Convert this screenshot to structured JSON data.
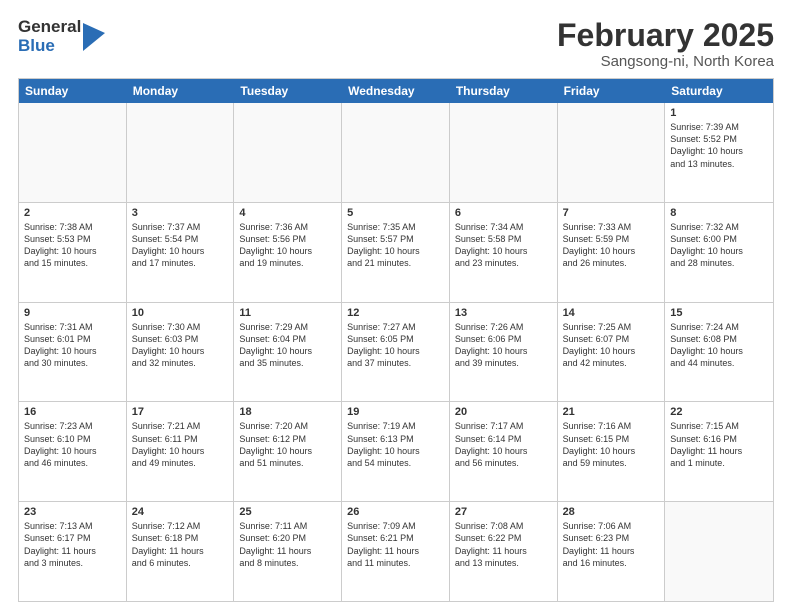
{
  "header": {
    "logo_general": "General",
    "logo_blue": "Blue",
    "title": "February 2025",
    "location": "Sangsong-ni, North Korea"
  },
  "calendar": {
    "days_of_week": [
      "Sunday",
      "Monday",
      "Tuesday",
      "Wednesday",
      "Thursday",
      "Friday",
      "Saturday"
    ],
    "rows": [
      [
        {
          "day": "",
          "info": "",
          "empty": true
        },
        {
          "day": "",
          "info": "",
          "empty": true
        },
        {
          "day": "",
          "info": "",
          "empty": true
        },
        {
          "day": "",
          "info": "",
          "empty": true
        },
        {
          "day": "",
          "info": "",
          "empty": true
        },
        {
          "day": "",
          "info": "",
          "empty": true
        },
        {
          "day": "1",
          "info": "Sunrise: 7:39 AM\nSunset: 5:52 PM\nDaylight: 10 hours\nand 13 minutes."
        }
      ],
      [
        {
          "day": "2",
          "info": "Sunrise: 7:38 AM\nSunset: 5:53 PM\nDaylight: 10 hours\nand 15 minutes."
        },
        {
          "day": "3",
          "info": "Sunrise: 7:37 AM\nSunset: 5:54 PM\nDaylight: 10 hours\nand 17 minutes."
        },
        {
          "day": "4",
          "info": "Sunrise: 7:36 AM\nSunset: 5:56 PM\nDaylight: 10 hours\nand 19 minutes."
        },
        {
          "day": "5",
          "info": "Sunrise: 7:35 AM\nSunset: 5:57 PM\nDaylight: 10 hours\nand 21 minutes."
        },
        {
          "day": "6",
          "info": "Sunrise: 7:34 AM\nSunset: 5:58 PM\nDaylight: 10 hours\nand 23 minutes."
        },
        {
          "day": "7",
          "info": "Sunrise: 7:33 AM\nSunset: 5:59 PM\nDaylight: 10 hours\nand 26 minutes."
        },
        {
          "day": "8",
          "info": "Sunrise: 7:32 AM\nSunset: 6:00 PM\nDaylight: 10 hours\nand 28 minutes."
        }
      ],
      [
        {
          "day": "9",
          "info": "Sunrise: 7:31 AM\nSunset: 6:01 PM\nDaylight: 10 hours\nand 30 minutes."
        },
        {
          "day": "10",
          "info": "Sunrise: 7:30 AM\nSunset: 6:03 PM\nDaylight: 10 hours\nand 32 minutes."
        },
        {
          "day": "11",
          "info": "Sunrise: 7:29 AM\nSunset: 6:04 PM\nDaylight: 10 hours\nand 35 minutes."
        },
        {
          "day": "12",
          "info": "Sunrise: 7:27 AM\nSunset: 6:05 PM\nDaylight: 10 hours\nand 37 minutes."
        },
        {
          "day": "13",
          "info": "Sunrise: 7:26 AM\nSunset: 6:06 PM\nDaylight: 10 hours\nand 39 minutes."
        },
        {
          "day": "14",
          "info": "Sunrise: 7:25 AM\nSunset: 6:07 PM\nDaylight: 10 hours\nand 42 minutes."
        },
        {
          "day": "15",
          "info": "Sunrise: 7:24 AM\nSunset: 6:08 PM\nDaylight: 10 hours\nand 44 minutes."
        }
      ],
      [
        {
          "day": "16",
          "info": "Sunrise: 7:23 AM\nSunset: 6:10 PM\nDaylight: 10 hours\nand 46 minutes."
        },
        {
          "day": "17",
          "info": "Sunrise: 7:21 AM\nSunset: 6:11 PM\nDaylight: 10 hours\nand 49 minutes."
        },
        {
          "day": "18",
          "info": "Sunrise: 7:20 AM\nSunset: 6:12 PM\nDaylight: 10 hours\nand 51 minutes."
        },
        {
          "day": "19",
          "info": "Sunrise: 7:19 AM\nSunset: 6:13 PM\nDaylight: 10 hours\nand 54 minutes."
        },
        {
          "day": "20",
          "info": "Sunrise: 7:17 AM\nSunset: 6:14 PM\nDaylight: 10 hours\nand 56 minutes."
        },
        {
          "day": "21",
          "info": "Sunrise: 7:16 AM\nSunset: 6:15 PM\nDaylight: 10 hours\nand 59 minutes."
        },
        {
          "day": "22",
          "info": "Sunrise: 7:15 AM\nSunset: 6:16 PM\nDaylight: 11 hours\nand 1 minute."
        }
      ],
      [
        {
          "day": "23",
          "info": "Sunrise: 7:13 AM\nSunset: 6:17 PM\nDaylight: 11 hours\nand 3 minutes."
        },
        {
          "day": "24",
          "info": "Sunrise: 7:12 AM\nSunset: 6:18 PM\nDaylight: 11 hours\nand 6 minutes."
        },
        {
          "day": "25",
          "info": "Sunrise: 7:11 AM\nSunset: 6:20 PM\nDaylight: 11 hours\nand 8 minutes."
        },
        {
          "day": "26",
          "info": "Sunrise: 7:09 AM\nSunset: 6:21 PM\nDaylight: 11 hours\nand 11 minutes."
        },
        {
          "day": "27",
          "info": "Sunrise: 7:08 AM\nSunset: 6:22 PM\nDaylight: 11 hours\nand 13 minutes."
        },
        {
          "day": "28",
          "info": "Sunrise: 7:06 AM\nSunset: 6:23 PM\nDaylight: 11 hours\nand 16 minutes."
        },
        {
          "day": "",
          "info": "",
          "empty": true
        }
      ]
    ]
  }
}
